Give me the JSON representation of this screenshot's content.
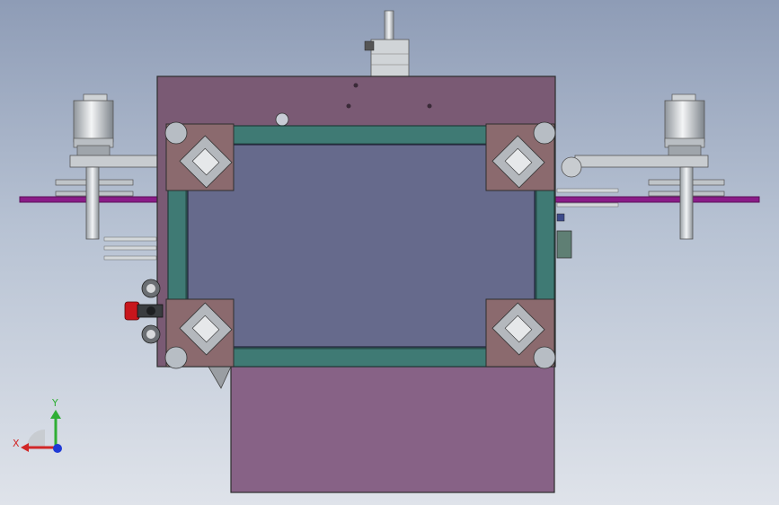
{
  "viewport": {
    "background_top": "#8e9cb6",
    "background_bottom": "#dfe3ea"
  },
  "model": {
    "frame_color": "#7a5a74",
    "lower_plate_color": "#876286",
    "window_color": "#666a8c",
    "inner_frame_color": "#3f7a74",
    "corner_block_color": "#8b6a6e",
    "rail_color": "#8a1c88"
  },
  "triad": {
    "x_label": "X",
    "y_label": "Y",
    "x_color": "#d12626",
    "y_color": "#2fae35",
    "z_color": "#1f3ad6"
  }
}
